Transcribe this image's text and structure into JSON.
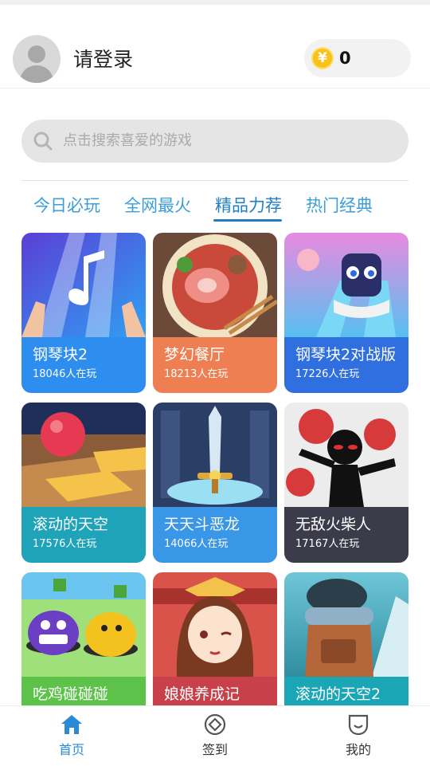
{
  "header": {
    "login_text": "请登录",
    "coin_symbol": "¥",
    "coin_count": "0"
  },
  "search": {
    "placeholder": "点击搜索喜爱的游戏"
  },
  "tabs": [
    {
      "label": "今日必玩",
      "active": false
    },
    {
      "label": "全网最火",
      "active": false
    },
    {
      "label": "精品力荐",
      "active": true
    },
    {
      "label": "热门经典",
      "active": false
    }
  ],
  "games": [
    {
      "title": "钢琴块2",
      "players": "18046人在玩",
      "color": "#2e8ef0"
    },
    {
      "title": "梦幻餐厅",
      "players": "18213人在玩",
      "color": "#ee7f52"
    },
    {
      "title": "钢琴块2对战版",
      "players": "17226人在玩",
      "color": "#2f6fe0"
    },
    {
      "title": "滚动的天空",
      "players": "17576人在玩",
      "color": "#1fa3b8"
    },
    {
      "title": "天天斗恶龙",
      "players": "14066人在玩",
      "color": "#3a96e6"
    },
    {
      "title": "无敌火柴人",
      "players": "17167人在玩",
      "color": "#3b3b4a"
    },
    {
      "title": "吃鸡碰碰碰",
      "players": "",
      "color": "#5cc24a"
    },
    {
      "title": "娘娘养成记",
      "players": "",
      "color": "#c8414a"
    },
    {
      "title": "滚动的天空2",
      "players": "",
      "color": "#1aa6b5"
    }
  ],
  "bottom_nav": [
    {
      "label": "首页",
      "icon": "home-icon",
      "active": true
    },
    {
      "label": "签到",
      "icon": "checkin-icon",
      "active": false
    },
    {
      "label": "我的",
      "icon": "profile-icon",
      "active": false
    }
  ],
  "colors": {
    "accent": "#2a8ad6",
    "tab": "#3b9ed9"
  }
}
